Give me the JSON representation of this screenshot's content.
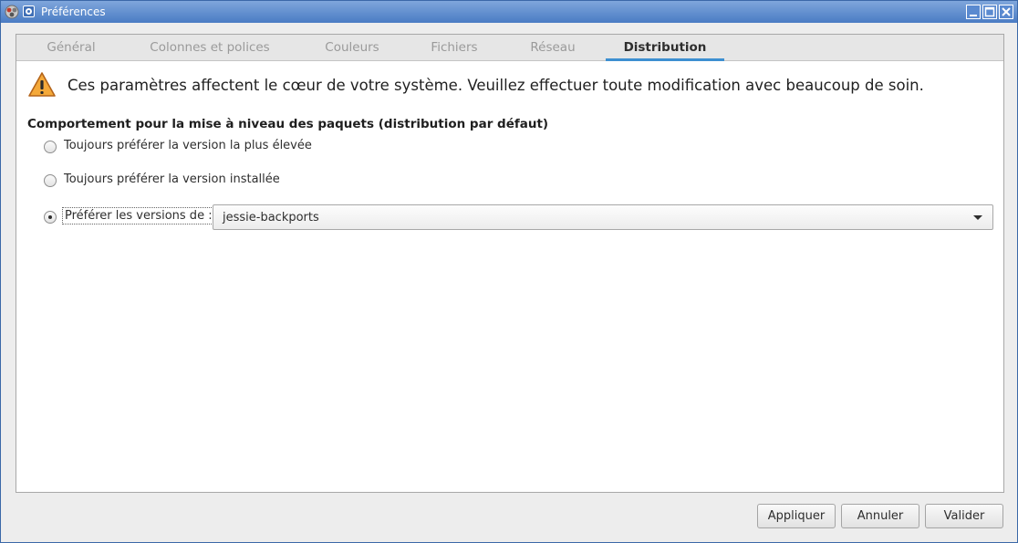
{
  "window": {
    "title": "Préférences"
  },
  "tabs": [
    {
      "label": "Général"
    },
    {
      "label": "Colonnes et polices"
    },
    {
      "label": "Couleurs"
    },
    {
      "label": "Fichiers"
    },
    {
      "label": "Réseau"
    },
    {
      "label": "Distribution",
      "active": true
    }
  ],
  "warning": {
    "text": "Ces paramètres affectent le cœur de votre système. Veuillez effectuer toute modification avec beaucoup de soin."
  },
  "section": {
    "label": "Comportement pour la mise à niveau des paquets (distribution par défaut)"
  },
  "options": [
    {
      "label": "Toujours préférer la version la plus élevée",
      "checked": false
    },
    {
      "label": "Toujours préférer la version installée",
      "checked": false
    },
    {
      "label": "Préférer les versions de :",
      "checked": true
    }
  ],
  "combo": {
    "value": "jessie-backports"
  },
  "buttons": {
    "apply": "Appliquer",
    "cancel": "Annuler",
    "ok": "Valider"
  },
  "colors": {
    "accent": "#3d8fd1",
    "titlebar": "#4a7cc4",
    "warning": "#f0a030"
  }
}
